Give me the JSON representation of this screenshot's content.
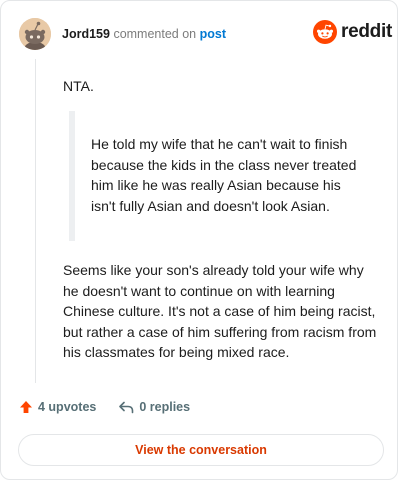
{
  "header": {
    "username": "Jord159",
    "action_text": "commented on",
    "post_link": "post",
    "brand": "reddit"
  },
  "comment": {
    "paragraph1": "NTA.",
    "quote": "He told my wife that he can't wait to finish because the kids in the class never treated him like he was really Asian because his isn't fully Asian and doesn't look Asian.",
    "paragraph2": "Seems like your son's already told your wife why he doesn't want to continue on with learning Chinese culture. It's not a case of him being racist, but rather a case of him suffering from racism from his classmates for being mixed race."
  },
  "actions": {
    "upvotes": "4 upvotes",
    "replies": "0 replies"
  },
  "footer": {
    "view_button": "View the conversation"
  },
  "colors": {
    "brand_orange": "#ff4500",
    "upvote_orange": "#ff4500",
    "link_blue": "#0079d3",
    "button_text": "#d93900"
  }
}
